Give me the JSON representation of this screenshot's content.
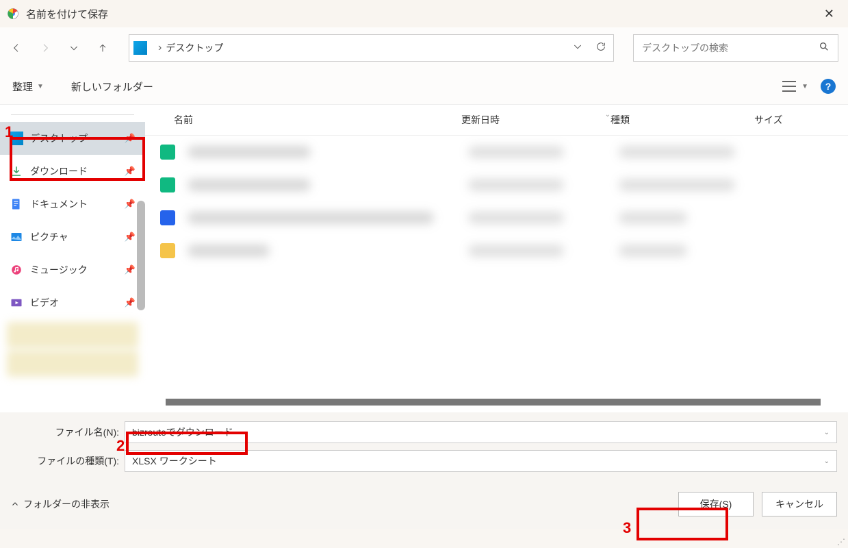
{
  "title": "名前を付けて保存",
  "breadcrumb": {
    "location": "デスクトップ"
  },
  "search": {
    "placeholder": "デスクトップの検索"
  },
  "toolbar": {
    "organize": "整理",
    "new_folder": "新しいフォルダー"
  },
  "sidebar": {
    "items": [
      {
        "label": "デスクトップ",
        "icon": "desktop",
        "selected": true
      },
      {
        "label": "ダウンロード",
        "icon": "download"
      },
      {
        "label": "ドキュメント",
        "icon": "document"
      },
      {
        "label": "ピクチャ",
        "icon": "pictures"
      },
      {
        "label": "ミュージック",
        "icon": "music"
      },
      {
        "label": "ビデオ",
        "icon": "video"
      }
    ]
  },
  "columns": {
    "name": "名前",
    "date": "更新日時",
    "type": "種類",
    "size": "サイズ"
  },
  "form": {
    "filename_label": "ファイル名(N):",
    "filename_value": "bizrouteでダウンロード",
    "filetype_label": "ファイルの種類(T):",
    "filetype_value": "XLSX ワークシート"
  },
  "footer": {
    "hide_folders": "フォルダーの非表示",
    "save": "保存(S)",
    "cancel": "キャンセル"
  },
  "annotations": {
    "a1": "1",
    "a2": "2",
    "a3": "3"
  }
}
